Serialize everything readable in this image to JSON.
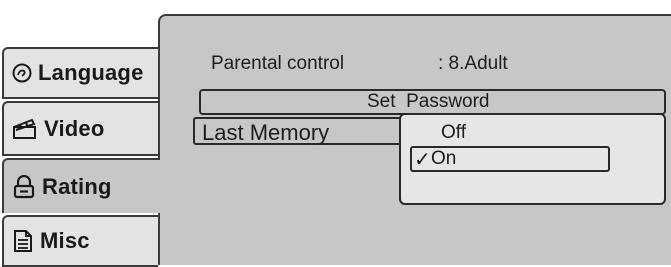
{
  "tabs": [
    {
      "label": "Language",
      "icon": "language-icon"
    },
    {
      "label": "Video",
      "icon": "clapperboard-icon"
    },
    {
      "label": "Rating",
      "icon": "lock-icon",
      "active": true
    },
    {
      "label": "Misc",
      "icon": "document-icon"
    }
  ],
  "rating": {
    "parental_label": "Parental control",
    "parental_value": ": 8.Adult",
    "set_password_label": "Set  Password",
    "last_memory_label": "Last Memory"
  },
  "dropdown": {
    "options": [
      {
        "label": "Off",
        "selected": false
      },
      {
        "label": "On",
        "selected": true
      }
    ],
    "check_glyph": "✓"
  },
  "colors": {
    "panel": "#c7c7c7",
    "tab": "#e3e3e3",
    "dropdown": "#e6e6e6",
    "border": "#2a2a2a"
  }
}
